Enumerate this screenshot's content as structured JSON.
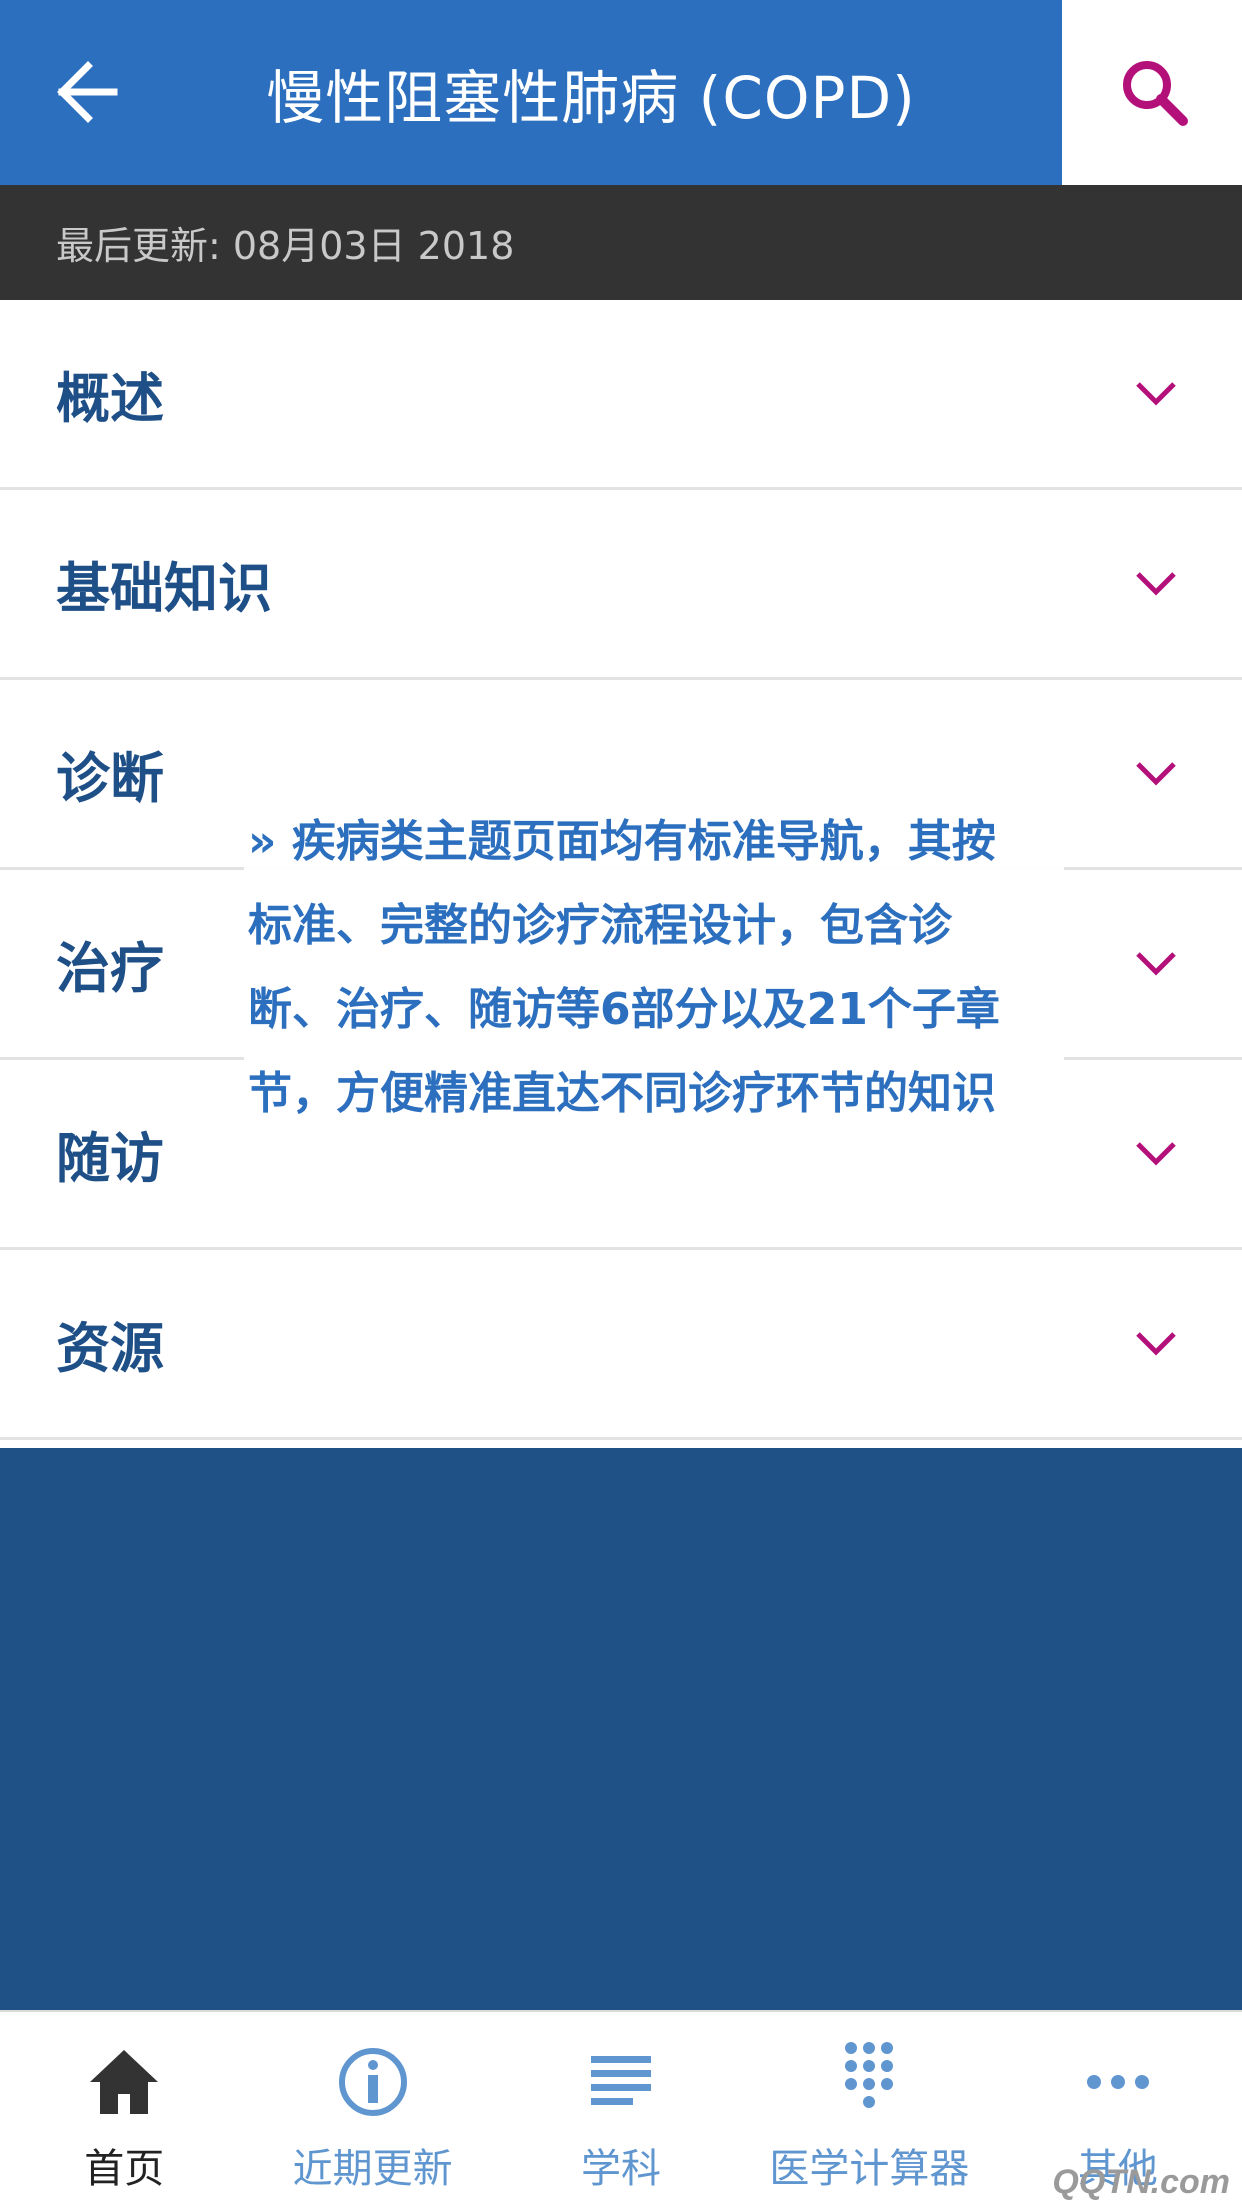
{
  "header": {
    "title": "慢性阻塞性肺病 (COPD)",
    "back_icon": "arrow-left-icon",
    "search_icon": "search-icon",
    "background_color": "#2c6fbe",
    "accent_color": "#b4107a"
  },
  "update_bar": {
    "text": "最后更新: 08月03日 2018"
  },
  "sections": [
    {
      "label": "概述"
    },
    {
      "label": "基础知识"
    },
    {
      "label": "诊断"
    },
    {
      "label": "治疗"
    },
    {
      "label": "随访"
    },
    {
      "label": "资源"
    }
  ],
  "callout": {
    "lines": [
      "» 疾病类主题页面均有标准导航，其按",
      "标准、完整的诊疗流程设计，包含诊",
      "断、治疗、随访等6部分以及21个子章",
      "节，方便精准直达不同诊疗环节的知识"
    ]
  },
  "bottom_nav": [
    {
      "label": "首页",
      "icon": "home-icon",
      "active": true
    },
    {
      "label": "近期更新",
      "icon": "info-icon",
      "active": false
    },
    {
      "label": "学科",
      "icon": "list-icon",
      "active": false
    },
    {
      "label": "医学计算器",
      "icon": "keypad-icon",
      "active": false
    },
    {
      "label": "其他",
      "icon": "more-icon",
      "active": false
    }
  ],
  "watermark": "QQTN.com"
}
